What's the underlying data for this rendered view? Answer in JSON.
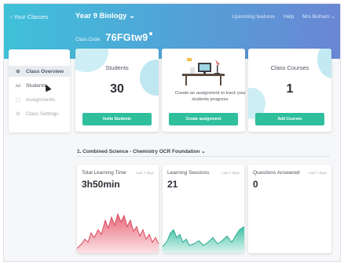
{
  "header": {
    "back_link": "‹ Your Classes",
    "class_title": "Year 9 Biology ⌄",
    "nav": [
      "Upcoming features",
      "Help",
      "Mrs Bolham ⌄"
    ],
    "class_code_label": "Class Code:",
    "class_code": "76FGtw9"
  },
  "sidebar": {
    "items": [
      {
        "label": "Class Overview",
        "icon": "globe-icon"
      },
      {
        "label": "Students",
        "icon": "students-icon"
      },
      {
        "label": "Assignments",
        "icon": "document-icon"
      },
      {
        "label": "Class Settings",
        "icon": "gear-icon"
      }
    ],
    "active": "Class Overview"
  },
  "cards": {
    "students": {
      "title": "Students",
      "count": "30",
      "button": "Invite Students"
    },
    "assignment": {
      "text": "Create an assignment to track your students progress.",
      "button": "Create assignment"
    },
    "courses": {
      "title": "Class Courses",
      "count": "1",
      "button": "Add Courses"
    }
  },
  "course_selector": "1. Combined Science - Chemistry OCR Foundation ⌄",
  "stats": [
    {
      "title": "Total Learning Time",
      "period": "Last 7 days",
      "value": "3h50min"
    },
    {
      "title": "Learning Sessions",
      "period": "Last 7 days",
      "value": "21"
    },
    {
      "title": "Questions Answered",
      "period": "Last 7 days",
      "value": "0"
    }
  ],
  "colors": {
    "header_start": "#3fc1d9",
    "header_end": "#6a86d4",
    "button_green": "#2fbf9d",
    "chart_red": "#e86a7a",
    "chart_teal": "#3dbfa6"
  }
}
